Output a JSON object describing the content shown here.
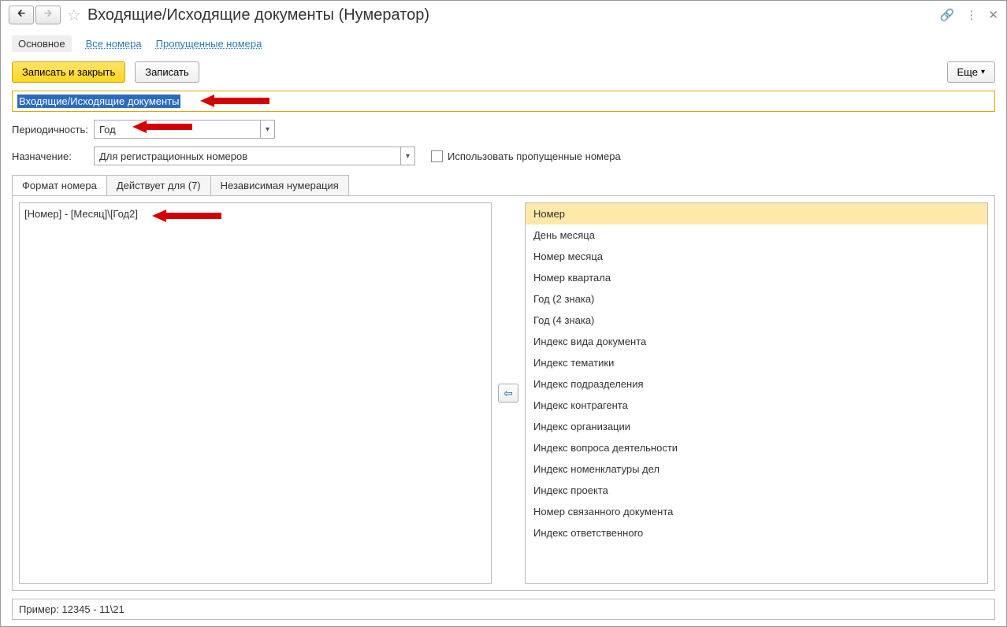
{
  "title": "Входящие/Исходящие документы (Нумератор)",
  "topTabs": {
    "main": "Основное",
    "all": "Все номера",
    "skipped": "Пропущенные номера"
  },
  "toolbar": {
    "saveClose": "Записать и закрыть",
    "save": "Записать",
    "more": "Еще"
  },
  "nameField": "Входящие/Исходящие документы",
  "period": {
    "label": "Периодичность:",
    "value": "Год"
  },
  "purpose": {
    "label": "Назначение:",
    "value": "Для регистрационных номеров"
  },
  "useSkipped": "Использовать пропущенные номера",
  "subtabs": {
    "format": "Формат номера",
    "applies": "Действует для (7)",
    "independent": "Независимая нумерация"
  },
  "formatValue": "[Номер] - [Месяц]\\[Год2]",
  "tokens": [
    "Номер",
    "День месяца",
    "Номер месяца",
    "Номер квартала",
    "Год (2 знака)",
    "Год (4 знака)",
    "Индекс вида документа",
    "Индекс тематики",
    "Индекс подразделения",
    "Индекс контрагента",
    "Индекс организации",
    "Индекс вопроса деятельности",
    "Индекс номенклатуры дел",
    "Индекс проекта",
    "Номер связанного документа",
    "Индекс ответственного"
  ],
  "example": "Пример: 12345 - 11\\21"
}
